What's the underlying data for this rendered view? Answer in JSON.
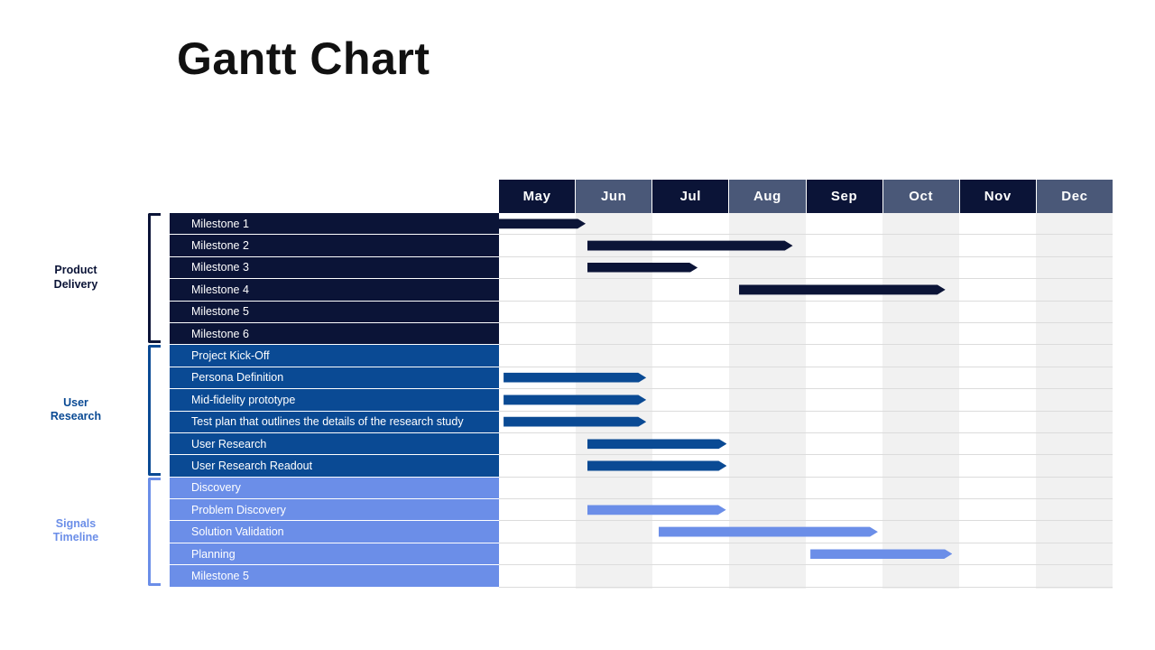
{
  "title": "Gantt Chart",
  "colors": {
    "group_product_delivery": "#0b1437",
    "group_user_research": "#0a4a94",
    "group_signals_timeline": "#6b8ee8",
    "header_dark": "#0b1437",
    "header_light": "#4a5878",
    "column_shade": "#f1f1f1"
  },
  "timeline": {
    "months": [
      {
        "label": "May",
        "style": "dark"
      },
      {
        "label": "Jun",
        "style": "light"
      },
      {
        "label": "Jul",
        "style": "dark"
      },
      {
        "label": "Aug",
        "style": "light"
      },
      {
        "label": "Sep",
        "style": "dark"
      },
      {
        "label": "Oct",
        "style": "light"
      },
      {
        "label": "Nov",
        "style": "dark"
      },
      {
        "label": "Dec",
        "style": "light"
      }
    ]
  },
  "groups": [
    {
      "name": "Product\nDelivery",
      "color": "#0b1437",
      "tasks": [
        {
          "label": "Milestone 1",
          "start_month": 0,
          "end_month": 1.13
        },
        {
          "label": "Milestone 2",
          "start_month": 1.15,
          "end_month": 3.83
        },
        {
          "label": "Milestone 3",
          "start_month": 1.15,
          "end_month": 2.59
        },
        {
          "label": "Milestone 4",
          "start_month": 3.13,
          "end_month": 5.82
        },
        {
          "label": "Milestone 5",
          "start_month": null,
          "end_month": null
        },
        {
          "label": "Milestone 6",
          "start_month": null,
          "end_month": null
        }
      ]
    },
    {
      "name": "User\nResearch",
      "color": "#0a4a94",
      "tasks": [
        {
          "label": "Project Kick-Off",
          "start_month": null,
          "end_month": null
        },
        {
          "label": "Persona Definition",
          "start_month": 0.06,
          "end_month": 1.92
        },
        {
          "label": "Mid-fidelity prototype",
          "start_month": 0.06,
          "end_month": 1.92
        },
        {
          "label": "Test plan that outlines the details of the research study",
          "start_month": 0.06,
          "end_month": 1.92
        },
        {
          "label": "User Research",
          "start_month": 1.15,
          "end_month": 2.97
        },
        {
          "label": "User Research Readout",
          "start_month": 1.15,
          "end_month": 2.97
        }
      ]
    },
    {
      "name": "Signals\nTimeline",
      "color": "#6b8ee8",
      "tasks": [
        {
          "label": "Discovery",
          "start_month": null,
          "end_month": null
        },
        {
          "label": "Problem Discovery",
          "start_month": 1.15,
          "end_month": 2.96
        },
        {
          "label": "Solution Validation",
          "start_month": 2.08,
          "end_month": 4.94
        },
        {
          "label": "Planning",
          "start_month": 4.06,
          "end_month": 5.91
        },
        {
          "label": "Milestone 5",
          "start_month": null,
          "end_month": null
        }
      ]
    }
  ],
  "chart_data": {
    "type": "bar",
    "title": "Gantt Chart",
    "xlabel": "",
    "ylabel": "",
    "categories": [
      "Milestone 1",
      "Milestone 2",
      "Milestone 3",
      "Milestone 4",
      "Milestone 5",
      "Milestone 6",
      "Project Kick-Off",
      "Persona Definition",
      "Mid-fidelity prototype",
      "Test plan that outlines the details of the research study",
      "User Research",
      "User Research Readout",
      "Discovery",
      "Problem Discovery",
      "Solution Validation",
      "Planning",
      "Milestone 5"
    ],
    "x_axis_ticks": [
      "May",
      "Jun",
      "Jul",
      "Aug",
      "Sep",
      "Oct",
      "Nov",
      "Dec"
    ],
    "series": [
      {
        "name": "Product Delivery",
        "color": "#0b1437",
        "values": [
          {
            "task": "Milestone 1",
            "start": "May",
            "end": "Jun"
          },
          {
            "task": "Milestone 2",
            "start": "Jun",
            "end": "Aug"
          },
          {
            "task": "Milestone 3",
            "start": "Jun",
            "end": "Jul"
          },
          {
            "task": "Milestone 4",
            "start": "Aug",
            "end": "Oct"
          },
          {
            "task": "Milestone 5",
            "start": null,
            "end": null
          },
          {
            "task": "Milestone 6",
            "start": null,
            "end": null
          }
        ]
      },
      {
        "name": "User Research",
        "color": "#0a4a94",
        "values": [
          {
            "task": "Project Kick-Off",
            "start": null,
            "end": null
          },
          {
            "task": "Persona Definition",
            "start": "May",
            "end": "Jul"
          },
          {
            "task": "Mid-fidelity prototype",
            "start": "May",
            "end": "Jul"
          },
          {
            "task": "Test plan that outlines the details of the research study",
            "start": "May",
            "end": "Jul"
          },
          {
            "task": "User Research",
            "start": "Jun",
            "end": "Aug"
          },
          {
            "task": "User Research Readout",
            "start": "Jun",
            "end": "Aug"
          }
        ]
      },
      {
        "name": "Signals Timeline",
        "color": "#6b8ee8",
        "values": [
          {
            "task": "Discovery",
            "start": null,
            "end": null
          },
          {
            "task": "Problem Discovery",
            "start": "Jun",
            "end": "Aug"
          },
          {
            "task": "Solution Validation",
            "start": "Jul",
            "end": "Oct"
          },
          {
            "task": "Planning",
            "start": "Sep",
            "end": "Oct"
          },
          {
            "task": "Milestone 5",
            "start": null,
            "end": null
          }
        ]
      }
    ],
    "grid": true,
    "legend": "left-brackets"
  }
}
